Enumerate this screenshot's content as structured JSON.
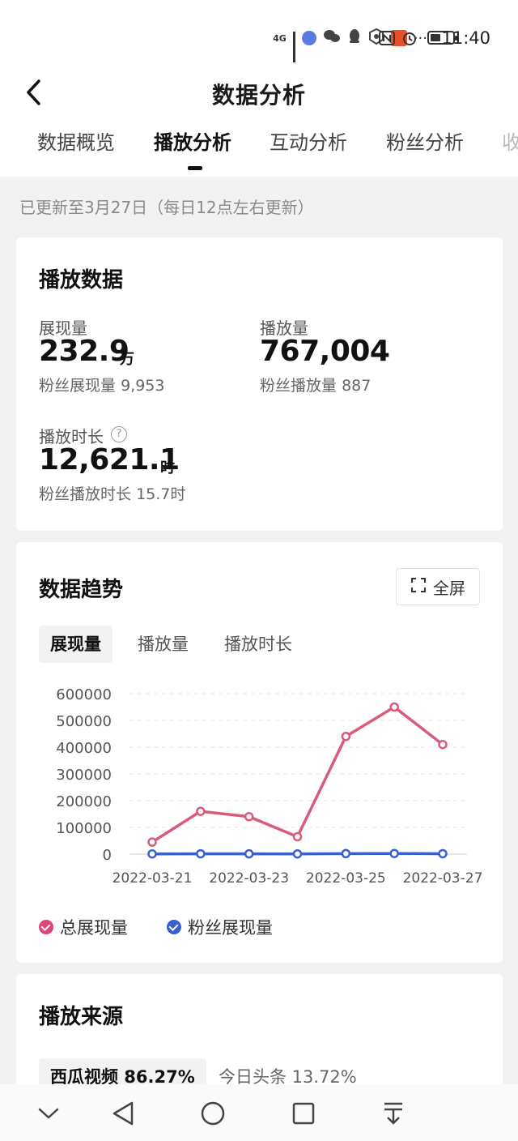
{
  "status_bar": {
    "network": "4G",
    "time": "11:40",
    "app_icons": [
      "music-icon",
      "wechat-icon",
      "qq-icon",
      "shield-app-icon",
      "game-app-icon"
    ],
    "more": "···"
  },
  "header": {
    "title": "数据分析",
    "tabs": [
      {
        "label": "数据概览",
        "active": false
      },
      {
        "label": "播放分析",
        "active": true
      },
      {
        "label": "互动分析",
        "active": false
      },
      {
        "label": "粉丝分析",
        "active": false
      },
      {
        "label": "收",
        "active": false
      }
    ]
  },
  "update_notice": "已更新至3月27日（每日12点左右更新）",
  "play_data": {
    "title": "播放数据",
    "impressions": {
      "label": "展现量",
      "value": "232.9",
      "unit": "万",
      "sub_label": "粉丝展现量",
      "sub_value": "9,953"
    },
    "plays": {
      "label": "播放量",
      "value": "767,004",
      "sub_label": "粉丝播放量",
      "sub_value": "887"
    },
    "duration": {
      "label": "播放时长",
      "value": "12,621.1",
      "unit": "时",
      "sub_label": "粉丝播放时长",
      "sub_value": "15.7时"
    }
  },
  "trend": {
    "title": "数据趋势",
    "fullscreen_label": "全屏",
    "subtabs": [
      {
        "label": "展现量",
        "active": true
      },
      {
        "label": "播放量",
        "active": false
      },
      {
        "label": "播放时长",
        "active": false
      }
    ],
    "legend": [
      {
        "label": "总展现量",
        "color": "#e05b7f"
      },
      {
        "label": "粉丝展现量",
        "color": "#3a5fd1"
      }
    ]
  },
  "chart_data": {
    "type": "line",
    "x": [
      "2022-03-21",
      "2022-03-22",
      "2022-03-23",
      "2022-03-24",
      "2022-03-25",
      "2022-03-26",
      "2022-03-27"
    ],
    "x_tick_labels": [
      "2022-03-21",
      "2022-03-23",
      "2022-03-25",
      "2022-03-27"
    ],
    "y_ticks": [
      0,
      100000,
      200000,
      300000,
      400000,
      500000,
      600000
    ],
    "ylim": [
      0,
      600000
    ],
    "grid": true,
    "series": [
      {
        "name": "总展现量",
        "color": "#d95b7a",
        "values": [
          45000,
          160000,
          140000,
          65000,
          440000,
          550000,
          410000
        ]
      },
      {
        "name": "粉丝展现量",
        "color": "#3a5fd1",
        "values": [
          900,
          1200,
          1100,
          800,
          1900,
          2300,
          1700
        ]
      }
    ]
  },
  "play_source": {
    "title": "播放来源",
    "sources": [
      {
        "label": "西瓜视频 86.27%",
        "active": true
      },
      {
        "label": "今日头条 13.72%",
        "active": false
      }
    ]
  },
  "nav": [
    "chevron-down-icon",
    "back-triangle-icon",
    "home-circle-icon",
    "recent-square-icon",
    "download-arrow-icon"
  ]
}
